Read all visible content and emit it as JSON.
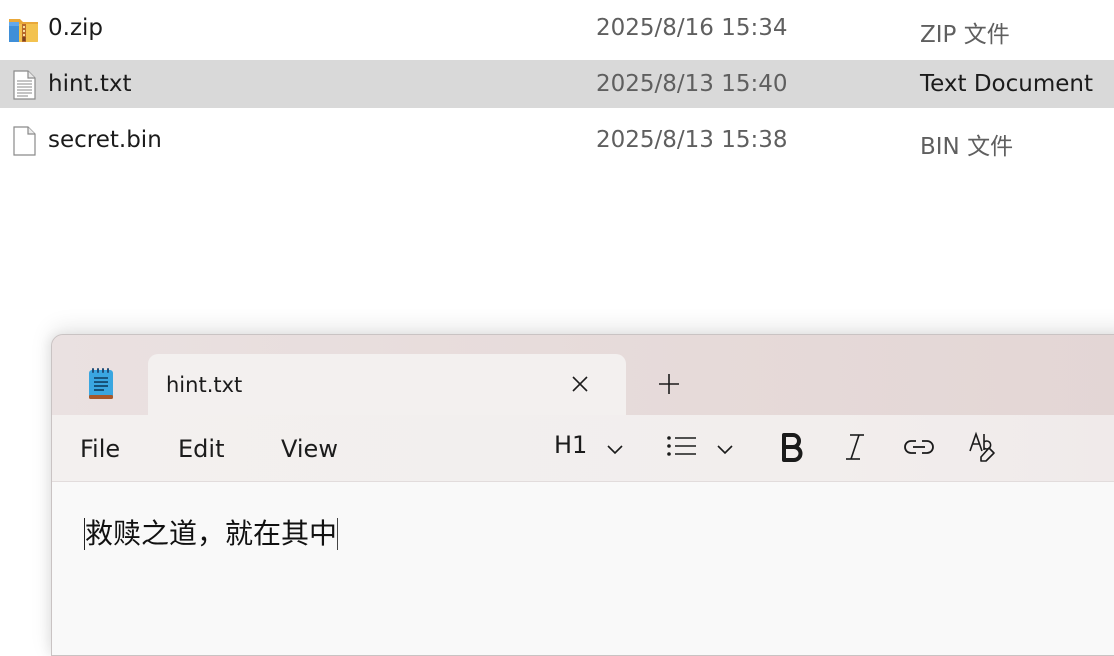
{
  "files": [
    {
      "name": "0.zip",
      "modified": "2025/8/16 15:34",
      "type": "ZIP 文件",
      "icon": "zip-folder-icon",
      "selected": false
    },
    {
      "name": "hint.txt",
      "modified": "2025/8/13 15:40",
      "type": "Text Document",
      "icon": "text-file-icon",
      "selected": true
    },
    {
      "name": "secret.bin",
      "modified": "2025/8/13 15:38",
      "type": "BIN 文件",
      "icon": "blank-file-icon",
      "selected": false
    }
  ],
  "notepad": {
    "app_icon": "notepad-icon",
    "tab_title": "hint.txt",
    "close_icon": "close-icon",
    "new_tab_icon": "plus-icon",
    "menu": {
      "file": "File",
      "edit": "Edit",
      "view": "View"
    },
    "toolbar": {
      "heading": "H1",
      "list_icon": "bulleted-list-icon",
      "bold_icon": "bold-icon",
      "italic_icon": "italic-icon",
      "link_icon": "link-icon",
      "spellcheck_icon": "spellcheck-icon"
    },
    "content": "救赎之道，就在其中"
  },
  "colors": {
    "selected_row": "#d9d9d9",
    "titlebar": "#e6dad9",
    "tab": "#f3f0ef",
    "editor_bg": "#f9f9f9",
    "secondary_text": "#5f5f5f"
  }
}
